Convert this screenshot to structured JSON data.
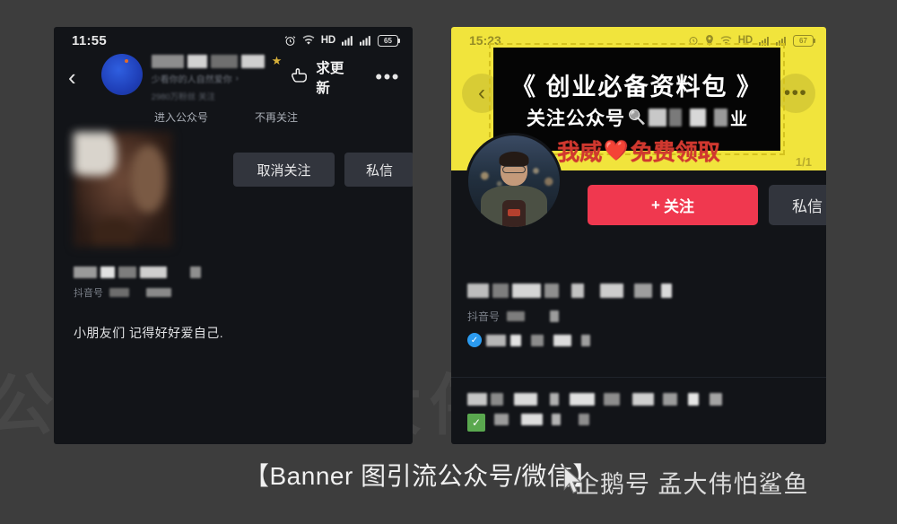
{
  "background_color": "#3d3d3d",
  "watermark": {
    "text": "公众号：孟大伟"
  },
  "left_phone": {
    "status_bar": {
      "time": "11:55",
      "icons": [
        "alarm-icon",
        "wifi-icon",
        "hd-icon",
        "signal-icon",
        "signal-icon",
        "battery-icon"
      ],
      "hd_label": "HD",
      "battery_level": "65"
    },
    "top_bar": {
      "back_icon": "chevron-left-icon",
      "request_update_label": "求更新",
      "request_update_icon": "pointing-hand-icon",
      "more_icon": "more-dots-icon"
    },
    "public_account": {
      "avatar_icon": "public-account-avatar",
      "name_blurred": "■■■ ■■",
      "star_icon": "star-icon",
      "tagline_blurred": "少看你的人自然爱你",
      "followers_blurred": "2980万粉丝 关注",
      "chevron_icon": "chevron-right-icon"
    },
    "links": [
      "进入公众号",
      "不再关注"
    ],
    "actions": {
      "unfollow_label": "取消关注",
      "dm_label": "私信",
      "caret_icon": "chevron-down-icon"
    },
    "profile": {
      "name_blurred": "■■■■■ ■",
      "douyin_label": "抖音号",
      "douyin_id_blurred": "■■■ ■■■"
    },
    "caption": "小朋友们 记得好好爱自己."
  },
  "right_phone": {
    "status_bar": {
      "time": "15:23",
      "icons": [
        "alarm-icon",
        "location-icon",
        "wifi-icon",
        "hd-icon",
        "signal-icon",
        "signal-icon",
        "battery-icon"
      ],
      "hd_label": "HD",
      "battery_level": "67"
    },
    "banner": {
      "background_color": "#f1e43c",
      "back_icon": "chevron-left-icon",
      "more_icon": "more-dots-icon",
      "page_counter": "1/1",
      "sticker": {
        "border_style": "dashed",
        "border_color": "#d4c21e",
        "line1": "《 创业必备资料包 》",
        "line2_prefix": "关注公众号",
        "line2_icon": "magnifier-icon",
        "line2_blurred": "■■ ■ ■",
        "line2_tail": "业"
      },
      "free_text_left": "我威",
      "free_heart_icon": "heart-icon",
      "free_text_right": "免费领取",
      "free_text_color": "#d0382f"
    },
    "profile": {
      "avatar_icon": "user-avatar-photo",
      "follow_label": "关注",
      "follow_plus_icon": "plus-icon",
      "follow_color": "#f0384f",
      "dm_label": "私信",
      "name_blurred": "■■■■■■：■ ■■■）",
      "douyin_label": "抖音号",
      "douyin_id_blurred": "■■ ■",
      "verified_icon": "verified-check-icon",
      "verified_text_blurred": "■■ ■ ■ ■■ ■",
      "second_block_blurred": "■■ ■■ ■ ■■ ■■ ■■ ■ ■ ■",
      "green_badge_icon": "green-check-icon",
      "green_block_blurred": "■ ■■ ■ ■■■■"
    }
  },
  "caption_bar": {
    "primary": "【Banner 图引流公众号/微信】",
    "secondary": "企鹅号 孟大伟怕鲨鱼",
    "cursor_icon": "mouse-cursor-icon"
  }
}
